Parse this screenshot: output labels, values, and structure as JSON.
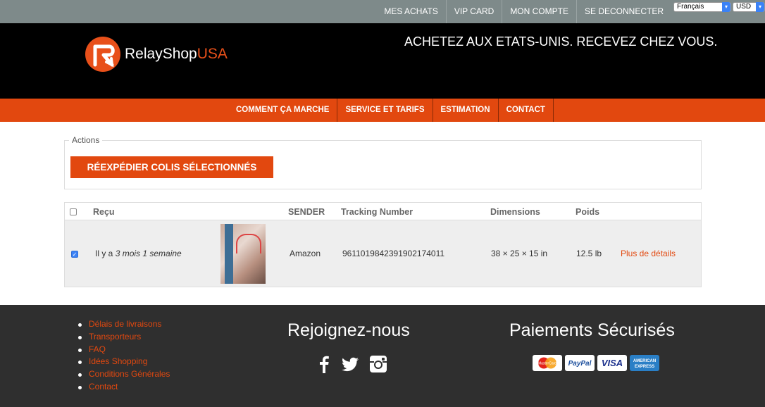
{
  "topnav": {
    "items": [
      "MES ACHATS",
      "VIP CARD",
      "MON COMPTE",
      "SE DECONNECTER"
    ],
    "language": "Français",
    "currency": "USD"
  },
  "header": {
    "logo_main": "RelayShop",
    "logo_accent": "USA",
    "tagline": "ACHETEZ AUX ETATS-UNIS. RECEVEZ CHEZ VOUS."
  },
  "mainnav": {
    "items": [
      "COMMENT ÇA MARCHE",
      "SERVICE ET TARIFS",
      "ESTIMATION",
      "CONTACT"
    ]
  },
  "actions": {
    "legend": "Actions",
    "reship_label": "RÉEXPÉDIER COLIS SÉLECTIONNÉS"
  },
  "table": {
    "headers": {
      "received": "Reçu",
      "sender": "SENDER",
      "tracking": "Tracking Number",
      "dimensions": "Dimensions",
      "weight": "Poids"
    },
    "rows": [
      {
        "received_prefix": "Il y a",
        "received_ago": "3 mois 1 semaine",
        "sender": "Amazon",
        "tracking": "9611019842391902174011",
        "dimensions": "38 × 25 × 15 in",
        "weight": "12.5 lb",
        "details_label": "Plus de détails",
        "selected": true
      }
    ]
  },
  "footer": {
    "links": [
      "Délais de livraisons",
      "Transporteurs",
      "FAQ",
      "Idées Shopping",
      "Conditions Générales",
      "Contact"
    ],
    "join_title": "Rejoignez-nous",
    "social": [
      "facebook-icon",
      "twitter-icon",
      "instagram-icon"
    ],
    "payment_title": "Paiements Sécurisés",
    "cards": {
      "mastercard": "MasterCard",
      "paypal": "PayPal",
      "visa": "VISA",
      "amex_line1": "AMERICAN",
      "amex_line2": "EXPRESS"
    }
  },
  "colors": {
    "accent": "#e2480f",
    "topbar": "#7e8a8a",
    "footer": "#2f2f2f"
  }
}
